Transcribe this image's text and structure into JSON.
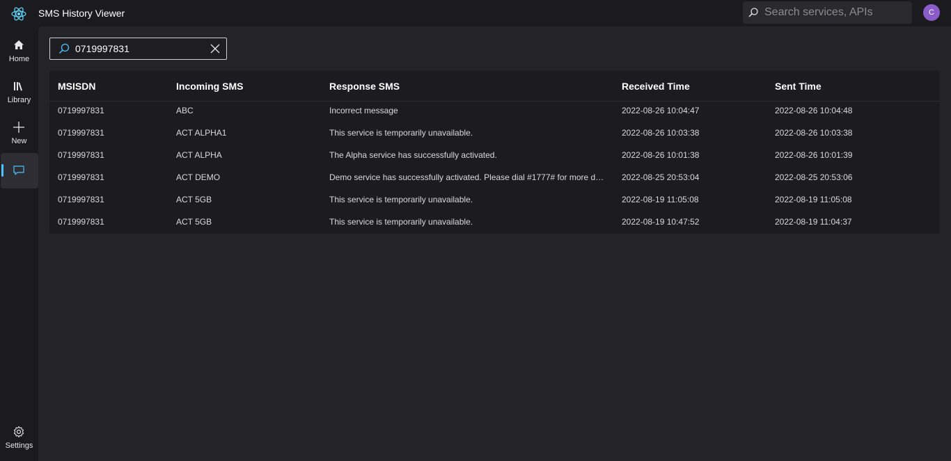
{
  "app": {
    "title": "SMS History Viewer",
    "search_placeholder": "Search services, APIs",
    "avatar_initial": "C",
    "accent_color": "#4cc2ff",
    "avatar_color": "#8a5cc9"
  },
  "nav": {
    "home": "Home",
    "library": "Library",
    "new": "New",
    "messages": "",
    "settings": "Settings"
  },
  "filter": {
    "value": "0719997831",
    "icon": "search-icon",
    "clear_icon": "close-icon"
  },
  "table": {
    "columns": [
      "MSISDN",
      "Incoming SMS",
      "Response SMS",
      "Received Time",
      "Sent Time"
    ],
    "rows": [
      [
        "0719997831",
        "ABC",
        "Incorrect message",
        "2022-08-26 10:04:47",
        "2022-08-26 10:04:48"
      ],
      [
        "0719997831",
        "ACT ALPHA1",
        "This service is temporarily unavailable.",
        "2022-08-26 10:03:38",
        "2022-08-26 10:03:38"
      ],
      [
        "0719997831",
        "ACT ALPHA",
        "The Alpha service has successfully activated.",
        "2022-08-26 10:01:38",
        "2022-08-26 10:01:39"
      ],
      [
        "0719997831",
        "ACT DEMO",
        "Demo service has successfully activated. Please dial #1777# for more deta...",
        "2022-08-25 20:53:04",
        "2022-08-25 20:53:06"
      ],
      [
        "0719997831",
        "ACT 5GB",
        "This service is temporarily unavailable.",
        "2022-08-19 11:05:08",
        "2022-08-19 11:05:08"
      ],
      [
        "0719997831",
        "ACT 5GB",
        "This service is temporarily unavailable.",
        "2022-08-19 10:47:52",
        "2022-08-19 11:04:37"
      ]
    ]
  }
}
